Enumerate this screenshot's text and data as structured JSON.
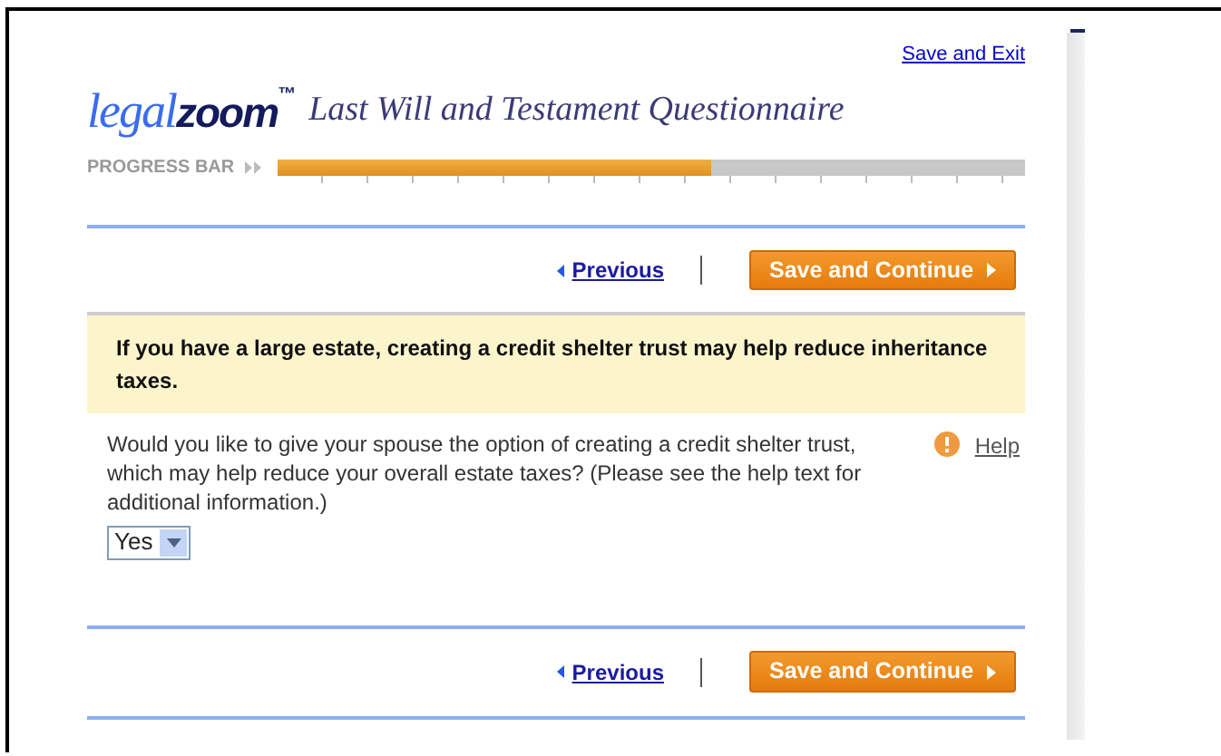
{
  "header": {
    "save_exit": "Save and Exit",
    "logo": {
      "part_1": "legal",
      "part_2": "zoom",
      "mark": "™"
    },
    "title": "Last Will and Testament Questionnaire"
  },
  "progress": {
    "label": "PROGRESS BAR",
    "level": 0.58
  },
  "nav_top": {
    "previous": "Previous",
    "continue": "Save and Continue"
  },
  "notice": "If you have a large estate, creating a credit shelter trust may help reduce inheritance taxes.",
  "question": {
    "text": "Would you like to give your spouse the option of creating a credit shelter trust, which may help reduce your overall estate taxes? (Please see the help text for additional information.)",
    "help": "Help",
    "answer": "Yes"
  },
  "nav_bottom": {
    "previous": "Previous",
    "continue": "Save and Continue"
  }
}
